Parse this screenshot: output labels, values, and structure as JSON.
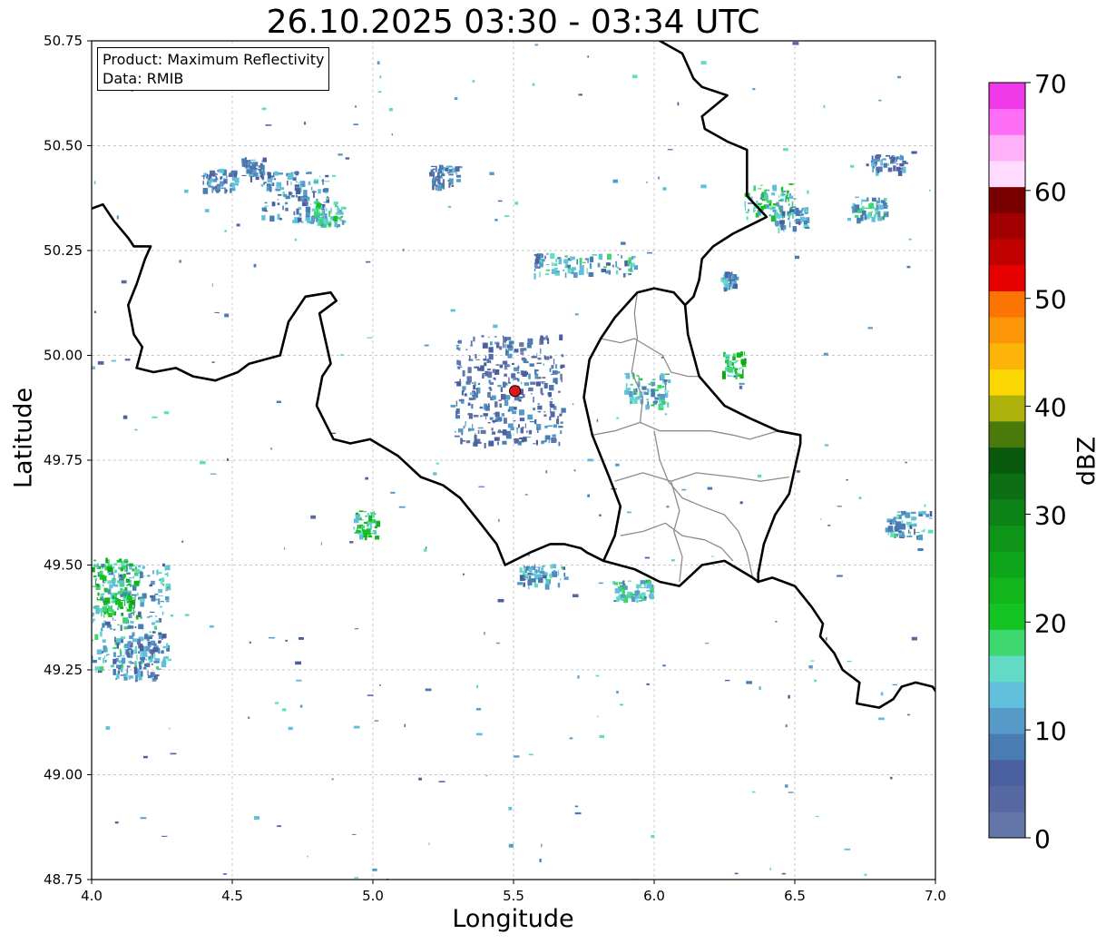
{
  "title": "26.10.2025 03:30 - 03:34 UTC",
  "info": {
    "product_line": "Product: Maximum Reflectivity",
    "data_line": "Data: RMIB"
  },
  "axes": {
    "xlabel": "Longitude",
    "ylabel": "Latitude",
    "xlim": [
      4.0,
      7.0
    ],
    "ylim": [
      48.75,
      50.75
    ],
    "xticks": [
      "4.0",
      "4.5",
      "5.0",
      "5.5",
      "6.0",
      "6.5",
      "7.0"
    ],
    "yticks": [
      "48.75",
      "49.00",
      "49.25",
      "49.50",
      "49.75",
      "50.00",
      "50.25",
      "50.50",
      "50.75"
    ],
    "grid": true
  },
  "colorbar": {
    "label": "dBZ",
    "ticks": [
      "0",
      "10",
      "20",
      "30",
      "40",
      "50",
      "60",
      "70"
    ],
    "range": [
      0,
      70
    ],
    "colors": [
      "#6476a8",
      "#5769a3",
      "#4a5fa0",
      "#4a7cb4",
      "#569ac8",
      "#62bfdb",
      "#62dbc6",
      "#3ed66f",
      "#14c422",
      "#13b51d",
      "#0fa51b",
      "#0e9518",
      "#0d8216",
      "#0d6f14",
      "#0a5a0e",
      "#4a7a0c",
      "#adb10a",
      "#fad703",
      "#fcb408",
      "#fc9606",
      "#fc7503",
      "#e60000",
      "#c10000",
      "#a20000",
      "#7a0000",
      "#ffdcff",
      "#ffb0f8",
      "#ff6ef6",
      "#f03ae9"
    ]
  },
  "radar_site": {
    "lon": 5.505,
    "lat": 49.915,
    "color": "#e3151c"
  },
  "echo_clusters": [
    {
      "lon": 4.12,
      "lat": 49.38,
      "w": 0.3,
      "h": 0.26,
      "dbz": 12
    },
    {
      "lon": 4.08,
      "lat": 49.45,
      "w": 0.16,
      "h": 0.14,
      "dbz": 20
    },
    {
      "lon": 4.15,
      "lat": 49.28,
      "w": 0.15,
      "h": 0.1,
      "dbz": 8
    },
    {
      "lon": 4.72,
      "lat": 50.38,
      "w": 0.24,
      "h": 0.12,
      "dbz": 10
    },
    {
      "lon": 4.83,
      "lat": 50.34,
      "w": 0.12,
      "h": 0.06,
      "dbz": 16
    },
    {
      "lon": 4.45,
      "lat": 50.42,
      "w": 0.12,
      "h": 0.05,
      "dbz": 8
    },
    {
      "lon": 4.57,
      "lat": 50.45,
      "w": 0.08,
      "h": 0.05,
      "dbz": 8
    },
    {
      "lon": 5.25,
      "lat": 50.43,
      "w": 0.1,
      "h": 0.05,
      "dbz": 8
    },
    {
      "lon": 6.41,
      "lat": 50.37,
      "w": 0.18,
      "h": 0.08,
      "dbz": 16
    },
    {
      "lon": 6.48,
      "lat": 50.33,
      "w": 0.12,
      "h": 0.05,
      "dbz": 12
    },
    {
      "lon": 6.76,
      "lat": 50.35,
      "w": 0.12,
      "h": 0.06,
      "dbz": 14
    },
    {
      "lon": 6.83,
      "lat": 50.46,
      "w": 0.12,
      "h": 0.04,
      "dbz": 8
    },
    {
      "lon": 6.9,
      "lat": 49.6,
      "w": 0.16,
      "h": 0.06,
      "dbz": 12
    },
    {
      "lon": 6.26,
      "lat": 50.18,
      "w": 0.05,
      "h": 0.04,
      "dbz": 10
    },
    {
      "lon": 5.75,
      "lat": 50.22,
      "w": 0.36,
      "h": 0.05,
      "dbz": 12
    },
    {
      "lon": 6.28,
      "lat": 49.98,
      "w": 0.08,
      "h": 0.06,
      "dbz": 20
    },
    {
      "lon": 5.97,
      "lat": 49.92,
      "w": 0.16,
      "h": 0.08,
      "dbz": 14
    },
    {
      "lon": 5.6,
      "lat": 49.48,
      "w": 0.18,
      "h": 0.05,
      "dbz": 12
    },
    {
      "lon": 5.92,
      "lat": 49.44,
      "w": 0.14,
      "h": 0.05,
      "dbz": 14
    },
    {
      "lon": 5.48,
      "lat": 49.92,
      "w": 0.38,
      "h": 0.26,
      "dbz": 6
    },
    {
      "lon": 4.97,
      "lat": 49.6,
      "w": 0.08,
      "h": 0.06,
      "dbz": 18
    }
  ],
  "borders": {
    "national": [
      [
        [
          4.0,
          50.35
        ],
        [
          4.04,
          50.36
        ],
        [
          4.08,
          50.32
        ],
        [
          4.13,
          50.28
        ],
        [
          4.15,
          50.26
        ],
        [
          4.21,
          50.26
        ],
        [
          4.19,
          50.23
        ],
        [
          4.16,
          50.17
        ],
        [
          4.13,
          50.12
        ],
        [
          4.15,
          50.05
        ],
        [
          4.18,
          50.02
        ],
        [
          4.16,
          49.97
        ],
        [
          4.22,
          49.96
        ],
        [
          4.3,
          49.97
        ],
        [
          4.36,
          49.95
        ],
        [
          4.44,
          49.94
        ],
        [
          4.52,
          49.96
        ],
        [
          4.56,
          49.98
        ],
        [
          4.67,
          50.0
        ],
        [
          4.7,
          50.08
        ],
        [
          4.76,
          50.14
        ],
        [
          4.85,
          50.15
        ],
        [
          4.87,
          50.13
        ],
        [
          4.81,
          50.1
        ],
        [
          4.85,
          49.98
        ],
        [
          4.82,
          49.95
        ],
        [
          4.8,
          49.88
        ],
        [
          4.86,
          49.8
        ],
        [
          4.92,
          49.79
        ],
        [
          4.99,
          49.8
        ],
        [
          5.09,
          49.76
        ],
        [
          5.17,
          49.71
        ],
        [
          5.25,
          49.69
        ],
        [
          5.31,
          49.66
        ],
        [
          5.37,
          49.61
        ],
        [
          5.44,
          49.55
        ],
        [
          5.47,
          49.5
        ],
        [
          5.56,
          49.53
        ],
        [
          5.63,
          49.55
        ],
        [
          5.68,
          49.55
        ],
        [
          5.74,
          49.54
        ],
        [
          5.76,
          49.53
        ],
        [
          5.82,
          49.51
        ],
        [
          5.93,
          49.49
        ],
        [
          6.02,
          49.46
        ],
        [
          6.09,
          49.45
        ],
        [
          6.17,
          49.5
        ],
        [
          6.25,
          49.51
        ],
        [
          6.35,
          49.47
        ],
        [
          6.37,
          49.46
        ],
        [
          6.37,
          49.48
        ]
      ],
      [
        [
          6.37,
          49.46
        ],
        [
          6.42,
          49.47
        ],
        [
          6.5,
          49.45
        ],
        [
          6.56,
          49.4
        ],
        [
          6.6,
          49.36
        ],
        [
          6.59,
          49.33
        ],
        [
          6.64,
          49.29
        ],
        [
          6.67,
          49.25
        ],
        [
          6.73,
          49.22
        ],
        [
          6.72,
          49.17
        ],
        [
          6.8,
          49.16
        ],
        [
          6.85,
          49.18
        ],
        [
          6.88,
          49.21
        ],
        [
          6.93,
          49.22
        ],
        [
          6.99,
          49.21
        ],
        [
          7.0,
          49.2
        ]
      ],
      [
        [
          6.37,
          49.48
        ],
        [
          6.39,
          49.55
        ],
        [
          6.43,
          49.62
        ],
        [
          6.48,
          49.67
        ],
        [
          6.5,
          49.73
        ],
        [
          6.52,
          49.79
        ],
        [
          6.52,
          49.81
        ],
        [
          6.44,
          49.82
        ],
        [
          6.34,
          49.85
        ],
        [
          6.25,
          49.88
        ],
        [
          6.16,
          49.95
        ],
        [
          6.12,
          50.05
        ],
        [
          6.11,
          50.12
        ],
        [
          6.07,
          50.15
        ],
        [
          6.0,
          50.16
        ],
        [
          5.94,
          50.15
        ],
        [
          5.86,
          50.09
        ],
        [
          5.81,
          50.04
        ],
        [
          5.77,
          49.99
        ],
        [
          5.75,
          49.9
        ],
        [
          5.78,
          49.81
        ],
        [
          5.84,
          49.71
        ],
        [
          5.88,
          49.64
        ],
        [
          5.86,
          49.57
        ],
        [
          5.82,
          49.51
        ]
      ],
      [
        [
          6.11,
          50.12
        ],
        [
          6.14,
          50.14
        ],
        [
          6.16,
          50.18
        ],
        [
          6.17,
          50.23
        ],
        [
          6.21,
          50.26
        ],
        [
          6.28,
          50.29
        ],
        [
          6.37,
          50.32
        ],
        [
          6.4,
          50.33
        ],
        [
          6.33,
          50.38
        ],
        [
          6.33,
          50.49
        ],
        [
          6.26,
          50.51
        ],
        [
          6.18,
          50.54
        ],
        [
          6.17,
          50.57
        ],
        [
          6.26,
          50.62
        ],
        [
          6.17,
          50.64
        ],
        [
          6.14,
          50.66
        ],
        [
          6.1,
          50.72
        ],
        [
          6.02,
          50.75
        ]
      ]
    ],
    "regional": [
      [
        [
          5.81,
          50.04
        ],
        [
          5.88,
          50.03
        ],
        [
          5.93,
          50.04
        ],
        [
          5.98,
          50.02
        ],
        [
          6.03,
          50.0
        ],
        [
          6.06,
          49.96
        ],
        [
          6.12,
          49.95
        ],
        [
          6.16,
          49.95
        ]
      ],
      [
        [
          5.78,
          49.81
        ],
        [
          5.86,
          49.82
        ],
        [
          5.95,
          49.84
        ],
        [
          6.02,
          49.82
        ],
        [
          6.1,
          49.82
        ],
        [
          6.2,
          49.82
        ],
        [
          6.28,
          49.81
        ],
        [
          6.34,
          49.8
        ],
        [
          6.44,
          49.82
        ]
      ],
      [
        [
          6.0,
          49.82
        ],
        [
          6.02,
          49.75
        ],
        [
          6.05,
          49.7
        ],
        [
          6.1,
          49.66
        ],
        [
          6.17,
          49.64
        ],
        [
          6.25,
          49.62
        ],
        [
          6.3,
          49.58
        ],
        [
          6.33,
          49.53
        ],
        [
          6.35,
          49.47
        ]
      ],
      [
        [
          5.86,
          49.7
        ],
        [
          5.96,
          49.72
        ],
        [
          6.06,
          49.7
        ],
        [
          6.15,
          49.72
        ],
        [
          6.28,
          49.71
        ],
        [
          6.38,
          49.7
        ],
        [
          6.48,
          49.71
        ]
      ],
      [
        [
          5.88,
          49.57
        ],
        [
          5.96,
          49.58
        ],
        [
          6.04,
          49.6
        ],
        [
          6.1,
          49.57
        ],
        [
          6.18,
          49.56
        ],
        [
          6.24,
          49.54
        ],
        [
          6.28,
          49.51
        ]
      ],
      [
        [
          6.06,
          49.7
        ],
        [
          6.09,
          49.63
        ],
        [
          6.07,
          49.58
        ],
        [
          6.1,
          49.52
        ],
        [
          6.09,
          49.46
        ]
      ],
      [
        [
          5.95,
          49.84
        ],
        [
          5.96,
          49.9
        ],
        [
          5.92,
          49.96
        ],
        [
          5.94,
          50.04
        ],
        [
          5.93,
          50.1
        ],
        [
          5.94,
          50.15
        ]
      ]
    ]
  }
}
